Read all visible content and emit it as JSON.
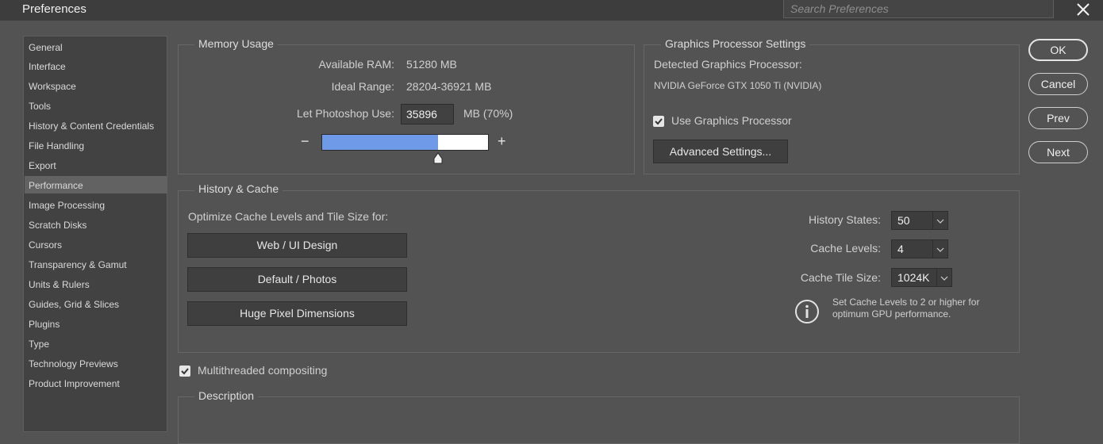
{
  "window": {
    "title": "Preferences",
    "search_placeholder": "Search Preferences"
  },
  "sidebar": {
    "selected": "Performance",
    "items": [
      {
        "label": "General"
      },
      {
        "label": "Interface"
      },
      {
        "label": "Workspace"
      },
      {
        "label": "Tools"
      },
      {
        "label": "History & Content Credentials"
      },
      {
        "label": "File Handling"
      },
      {
        "label": "Export"
      },
      {
        "label": "Performance"
      },
      {
        "label": "Image Processing"
      },
      {
        "label": "Scratch Disks"
      },
      {
        "label": "Cursors"
      },
      {
        "label": "Transparency & Gamut"
      },
      {
        "label": "Units & Rulers"
      },
      {
        "label": "Guides, Grid & Slices"
      },
      {
        "label": "Plugins"
      },
      {
        "label": "Type"
      },
      {
        "label": "Technology Previews"
      },
      {
        "label": "Product Improvement"
      }
    ]
  },
  "memory": {
    "title": "Memory Usage",
    "available_label": "Available RAM:",
    "available_value": "51280 MB",
    "ideal_label": "Ideal Range:",
    "ideal_value": "28204-36921 MB",
    "use_label": "Let Photoshop Use:",
    "use_value": "35896",
    "use_suffix": "MB (70%)",
    "slider_fraction": 0.7,
    "minus": "−",
    "plus": "+"
  },
  "gpu": {
    "title": "Graphics Processor Settings",
    "detected_label": "Detected Graphics Processor:",
    "detected_value": "NVIDIA GeForce GTX 1050 Ti (NVIDIA)",
    "use_gpu_label": "Use Graphics Processor",
    "use_gpu_checked": true,
    "advanced_button": "Advanced Settings..."
  },
  "history_cache": {
    "title": "History & Cache",
    "optimize_label": "Optimize Cache Levels and Tile Size for:",
    "buttons": [
      "Web / UI Design",
      "Default / Photos",
      "Huge Pixel Dimensions"
    ],
    "history_states_label": "History States:",
    "history_states_value": "50",
    "cache_levels_label": "Cache Levels:",
    "cache_levels_value": "4",
    "tile_size_label": "Cache Tile Size:",
    "tile_size_value": "1024K",
    "info_text_1": "Set Cache Levels to 2 or higher for",
    "info_text_2": "optimum GPU performance."
  },
  "multithread": {
    "label": "Multithreaded compositing",
    "checked": true
  },
  "description": {
    "title": "Description"
  },
  "actions": {
    "ok": "OK",
    "cancel": "Cancel",
    "prev": "Prev",
    "next": "Next"
  },
  "colors": {
    "accent_fill": "#6e9ae8",
    "panel_bg": "#535353",
    "sidebar_bg": "#424242",
    "selected_bg": "#626262"
  }
}
